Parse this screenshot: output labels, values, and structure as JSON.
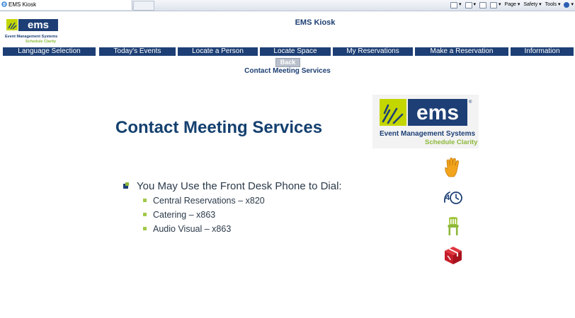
{
  "browser": {
    "tab_title": "EMS Kiosk",
    "commands": [
      "Page ▾",
      "Safety ▾",
      "Tools ▾"
    ]
  },
  "header": {
    "kiosk_title": "EMS Kiosk",
    "logo_small": {
      "wordmark": "ems",
      "name": "Event Management Systems",
      "tagline": "Schedule Clarity"
    }
  },
  "nav": {
    "items": [
      "Language Selection",
      "Today's Events",
      "Locate a Person",
      "Locate Space",
      "My Reservations",
      "Make a Reservation",
      "Information"
    ]
  },
  "back_label": "Back",
  "page_subtitle": "Contact Meeting Services",
  "content": {
    "heading": "Contact Meeting Services",
    "main_item": "You May Use the Front Desk Phone to Dial:",
    "sub_items": [
      "Central Reservations – x820",
      "Catering – x863",
      "Audio Visual – x863"
    ]
  },
  "logo_big": {
    "wordmark": "ems",
    "name": "Event Management Systems",
    "tagline": "Schedule Clarity"
  },
  "side_icons": [
    "hand-icon",
    "clock-icon",
    "chair-icon",
    "box-icon"
  ],
  "colors": {
    "navy": "#1d3f75",
    "brand_green": "#8cb83a",
    "lime": "#c4d600",
    "icon_orange": "#f0a01a",
    "icon_red": "#d0202e"
  }
}
